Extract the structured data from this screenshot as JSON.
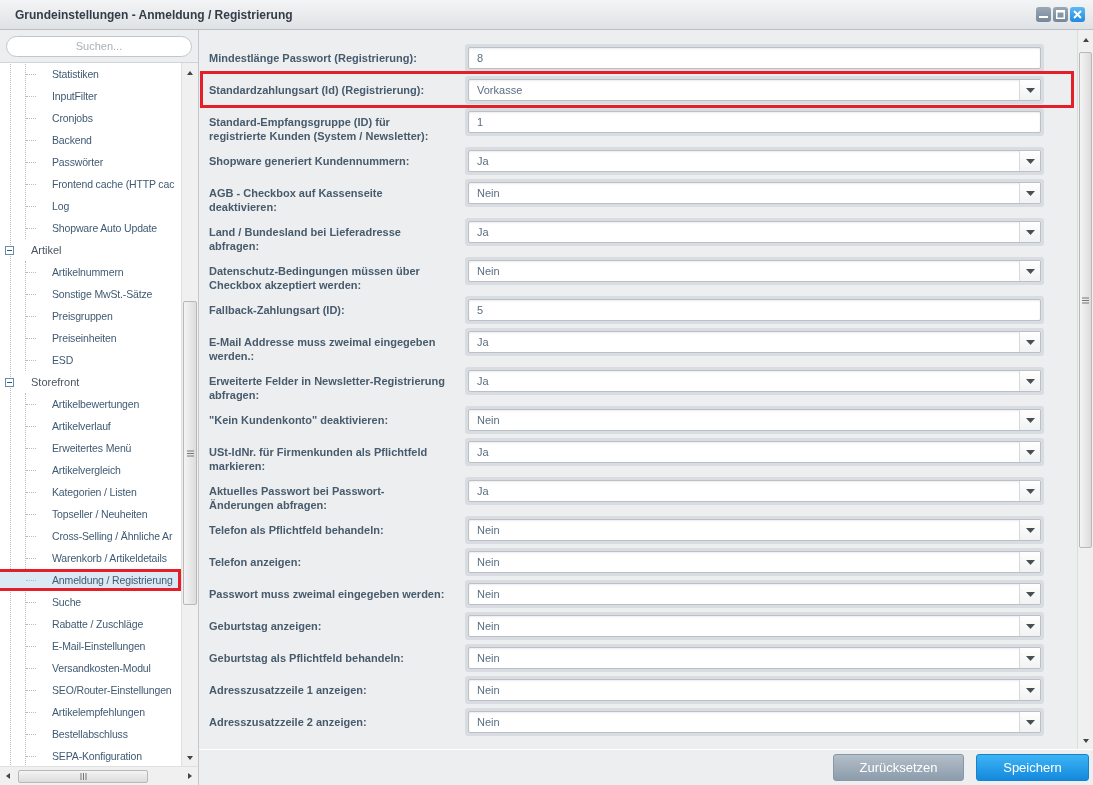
{
  "window": {
    "title": "Grundeinstellungen - Anmeldung / Registrierung"
  },
  "sidebar": {
    "search": {
      "placeholder": "Suchen..."
    },
    "tree": [
      {
        "children": [
          {
            "label": "Statistiken",
            "selected": false
          },
          {
            "label": "InputFilter",
            "selected": false
          },
          {
            "label": "Cronjobs",
            "selected": false
          },
          {
            "label": "Backend",
            "selected": false
          },
          {
            "label": "Passwörter",
            "selected": false
          },
          {
            "label": "Frontend cache (HTTP cac",
            "selected": false
          },
          {
            "label": "Log",
            "selected": false
          },
          {
            "label": "Shopware Auto Update",
            "selected": false
          }
        ]
      },
      {
        "label": "Artikel",
        "expanded": true,
        "children": [
          {
            "label": "Artikelnummern",
            "selected": false
          },
          {
            "label": "Sonstige MwSt.-Sätze",
            "selected": false
          },
          {
            "label": "Preisgruppen",
            "selected": false
          },
          {
            "label": "Preiseinheiten",
            "selected": false
          },
          {
            "label": "ESD",
            "selected": false
          }
        ]
      },
      {
        "label": "Storefront",
        "expanded": true,
        "children": [
          {
            "label": "Artikelbewertungen",
            "selected": false
          },
          {
            "label": "Artikelverlauf",
            "selected": false
          },
          {
            "label": "Erweitertes Menü",
            "selected": false
          },
          {
            "label": "Artikelvergleich",
            "selected": false
          },
          {
            "label": "Kategorien / Listen",
            "selected": false
          },
          {
            "label": "Topseller / Neuheiten",
            "selected": false
          },
          {
            "label": "Cross-Selling / Ähnliche Ar",
            "selected": false
          },
          {
            "label": "Warenkorb / Artikeldetails",
            "selected": false
          },
          {
            "label": "Anmeldung / Registrierung",
            "selected": true,
            "highlighted": true
          },
          {
            "label": "Suche",
            "selected": false
          },
          {
            "label": "Rabatte / Zuschläge",
            "selected": false
          },
          {
            "label": "E-Mail-Einstellungen",
            "selected": false
          },
          {
            "label": "Versandkosten-Modul",
            "selected": false
          },
          {
            "label": "SEO/Router-Einstellungen",
            "selected": false
          },
          {
            "label": "Artikelempfehlungen",
            "selected": false
          },
          {
            "label": "Bestellabschluss",
            "selected": false
          },
          {
            "label": "SEPA-Konfiguration",
            "selected": false
          }
        ]
      }
    ]
  },
  "form": {
    "fields": [
      {
        "kind": "text",
        "label": "Mindestlänge Passwort (Registrierung):",
        "value": "8"
      },
      {
        "kind": "select",
        "label": "Standardzahlungsart (Id) (Registrierung):",
        "value": "Vorkasse",
        "highlighted": true
      },
      {
        "kind": "text",
        "label": "Standard-Empfangsgruppe (ID) für registrierte Kunden (System / Newsletter):",
        "value": "1"
      },
      {
        "kind": "select",
        "label": "Shopware generiert Kundennummern:",
        "value": "Ja"
      },
      {
        "kind": "select",
        "label": "AGB - Checkbox auf Kassenseite deaktivieren:",
        "value": "Nein"
      },
      {
        "kind": "select",
        "label": "Land / Bundesland bei Lieferadresse abfragen:",
        "value": "Ja"
      },
      {
        "kind": "select",
        "label": "Datenschutz-Bedingungen müssen über Checkbox akzeptiert werden:",
        "value": "Nein"
      },
      {
        "kind": "text",
        "label": "Fallback-Zahlungsart (ID):",
        "value": "5"
      },
      {
        "kind": "select",
        "label": "E-Mail Addresse muss zweimal eingegeben werden.:",
        "value": "Ja"
      },
      {
        "kind": "select",
        "label": "Erweiterte Felder in Newsletter-Registrierung abfragen:",
        "value": "Ja"
      },
      {
        "kind": "select",
        "label": "\"Kein Kundenkonto\" deaktivieren:",
        "value": "Nein"
      },
      {
        "kind": "select",
        "label": "USt-IdNr. für Firmenkunden als Pflichtfeld markieren:",
        "value": "Ja"
      },
      {
        "kind": "select",
        "label": "Aktuelles Passwort bei Passwort-Änderungen abfragen:",
        "value": "Ja"
      },
      {
        "kind": "select",
        "label": "Telefon als Pflichtfeld behandeln:",
        "value": "Nein"
      },
      {
        "kind": "select",
        "label": "Telefon anzeigen:",
        "value": "Nein"
      },
      {
        "kind": "select",
        "label": "Passwort muss zweimal eingegeben werden:",
        "value": "Nein"
      },
      {
        "kind": "select",
        "label": "Geburtstag anzeigen:",
        "value": "Nein"
      },
      {
        "kind": "select",
        "label": "Geburtstag als Pflichtfeld behandeln:",
        "value": "Nein"
      },
      {
        "kind": "select",
        "label": "Adresszusatzzeile 1 anzeigen:",
        "value": "Nein"
      },
      {
        "kind": "select",
        "label": "Adresszusatzzeile 2 anzeigen:",
        "value": "Nein"
      }
    ]
  },
  "buttons": [
    {
      "kind": "secondary",
      "label": "Zurücksetzen"
    },
    {
      "kind": "primary",
      "label": "Speichern"
    }
  ]
}
